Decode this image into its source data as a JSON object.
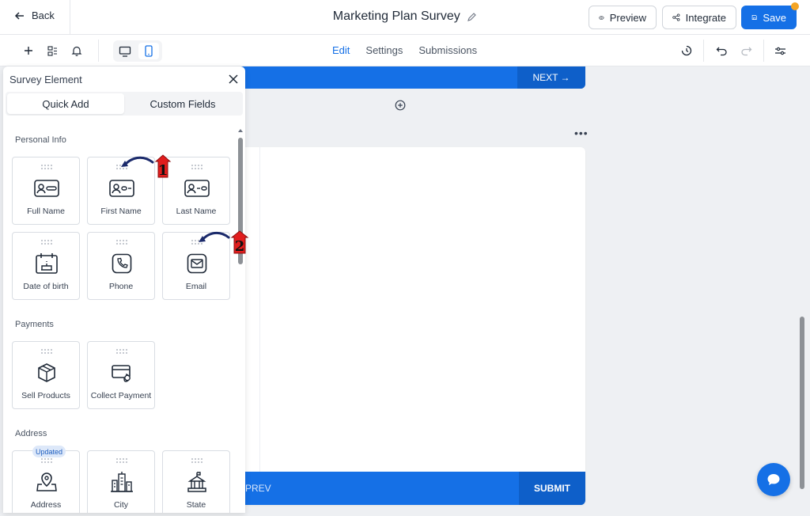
{
  "header": {
    "back_label": "Back",
    "title": "Marketing Plan Survey",
    "preview_label": "Preview",
    "integrate_label": "Integrate",
    "save_label": "Save"
  },
  "toolbar": {
    "tabs": [
      {
        "label": "Edit",
        "active": true
      },
      {
        "label": "Settings",
        "active": false
      },
      {
        "label": "Submissions",
        "active": false
      }
    ]
  },
  "canvas": {
    "next_label": "NEXT →",
    "prev_label": "PREV",
    "submit_label": "SUBMIT",
    "more_menu": "•••"
  },
  "panel": {
    "title": "Survey Element",
    "tabs": [
      {
        "label": "Quick Add",
        "active": true
      },
      {
        "label": "Custom Fields",
        "active": false
      }
    ],
    "sections": [
      {
        "label": "Personal Info",
        "items": [
          "Full Name",
          "First Name",
          "Last Name",
          "Date of birth",
          "Phone",
          "Email"
        ]
      },
      {
        "label": "Payments",
        "items": [
          "Sell Products",
          "Collect Payment"
        ]
      },
      {
        "label": "Address",
        "items": [
          "Address",
          "City",
          "State"
        ]
      }
    ],
    "updated_badge": "Updated"
  },
  "annotations": [
    "1",
    "2"
  ],
  "colors": {
    "accent": "#1570e6",
    "accent_dark": "#0e5fc9",
    "notification": "#f5a524",
    "annotation_red": "#e11d1d",
    "annotation_arrow": "#1b2a6b"
  }
}
